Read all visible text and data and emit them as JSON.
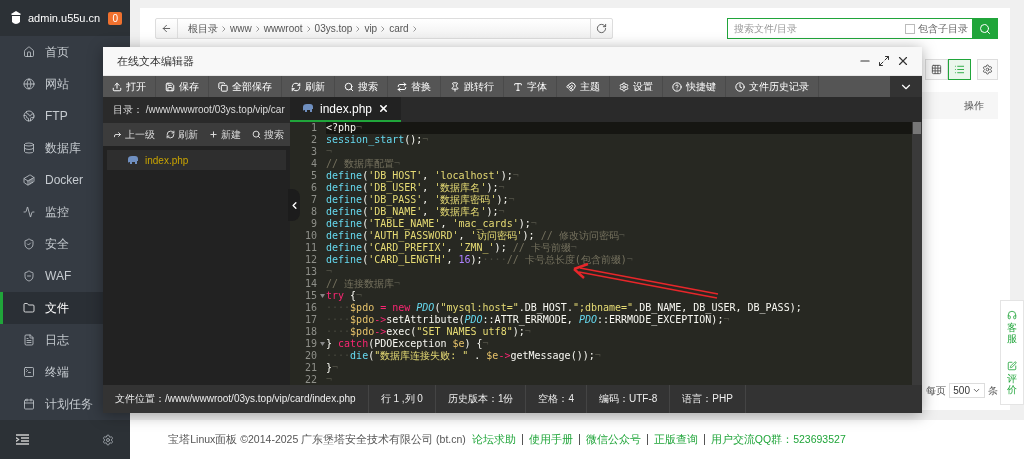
{
  "sidebar": {
    "site_name": "admin.u55u.cn",
    "badge": "0",
    "items": [
      {
        "label": "首页",
        "selected": false
      },
      {
        "label": "网站",
        "selected": false
      },
      {
        "label": "FTP",
        "selected": false
      },
      {
        "label": "数据库",
        "selected": false
      },
      {
        "label": "Docker",
        "selected": false
      },
      {
        "label": "监控",
        "selected": false
      },
      {
        "label": "安全",
        "selected": false
      },
      {
        "label": "WAF",
        "selected": false
      },
      {
        "label": "文件",
        "selected": true
      },
      {
        "label": "日志",
        "selected": false
      },
      {
        "label": "终端",
        "selected": false
      },
      {
        "label": "计划任务",
        "selected": false
      }
    ]
  },
  "breadcrumb": [
    "根目录",
    "www",
    "wwwroot",
    "03ys.top",
    "vip",
    "card"
  ],
  "search": {
    "placeholder": "搜索文件/目录",
    "include_subdirs": {
      "label": "包含子目录",
      "checked": false
    }
  },
  "view_toggle": [
    {
      "selected": false
    },
    {
      "selected": true
    }
  ],
  "table": {
    "columns": [
      "操作"
    ]
  },
  "pagination": {
    "prefix": "每页",
    "per_page": "500",
    "suffix": "条"
  },
  "float_widget": [
    "客服",
    "评价"
  ],
  "footer": {
    "text": "宝塔Linux面板 ©2014-2025 广东堡塔安全技术有限公司 (bt.cn)",
    "links": [
      "论坛求助",
      "使用手册",
      "微信公众号",
      "正版查询",
      "用户交流QQ群：523693527"
    ]
  },
  "editor": {
    "title": "在线文本编辑器",
    "toolbar": [
      "打开",
      "保存",
      "全部保存",
      "刷新",
      "搜索",
      "替换",
      "跳转行",
      "字体",
      "主题",
      "设置",
      "快捷键",
      "文件历史记录"
    ],
    "dir_label": "目录：",
    "dir_path": "/www/wwwroot/03ys.top/vip/car",
    "file_toolbar": [
      "上一级",
      "刷新",
      "新建",
      "搜索"
    ],
    "files": [
      {
        "name": "index.php",
        "selected": true
      }
    ],
    "tabs": [
      {
        "label": "index.php",
        "selected": true
      }
    ],
    "code": [
      {
        "number": "1",
        "active": true,
        "fold": false,
        "tokens": [
          {
            "kind": "plain",
            "text": "<?php"
          },
          {
            "kind": "ws",
            "text": "¬"
          }
        ]
      },
      {
        "number": "2",
        "active": false,
        "fold": false,
        "tokens": [
          {
            "kind": "func",
            "text": "session_start"
          },
          {
            "kind": "plain",
            "text": "();"
          },
          {
            "kind": "ws",
            "text": "¬"
          }
        ]
      },
      {
        "number": "3",
        "active": false,
        "fold": false,
        "tokens": [
          {
            "kind": "ws",
            "text": "¬"
          }
        ]
      },
      {
        "number": "4",
        "active": false,
        "fold": false,
        "tokens": [
          {
            "kind": "comment",
            "text": "// 数据库配置"
          },
          {
            "kind": "ws",
            "text": "¬"
          }
        ]
      },
      {
        "number": "5",
        "active": false,
        "fold": false,
        "tokens": [
          {
            "kind": "func",
            "text": "define"
          },
          {
            "kind": "plain",
            "text": "("
          },
          {
            "kind": "string",
            "text": "'DB_HOST'"
          },
          {
            "kind": "plain",
            "text": ", "
          },
          {
            "kind": "string",
            "text": "'localhost'"
          },
          {
            "kind": "plain",
            "text": ");"
          },
          {
            "kind": "ws",
            "text": "¬"
          }
        ]
      },
      {
        "number": "6",
        "active": false,
        "fold": false,
        "tokens": [
          {
            "kind": "func",
            "text": "define"
          },
          {
            "kind": "plain",
            "text": "("
          },
          {
            "kind": "string",
            "text": "'DB_USER'"
          },
          {
            "kind": "plain",
            "text": ", "
          },
          {
            "kind": "string",
            "text": "'数据库名'"
          },
          {
            "kind": "plain",
            "text": ");"
          },
          {
            "kind": "ws",
            "text": "¬"
          }
        ]
      },
      {
        "number": "7",
        "active": false,
        "fold": false,
        "tokens": [
          {
            "kind": "func",
            "text": "define"
          },
          {
            "kind": "plain",
            "text": "("
          },
          {
            "kind": "string",
            "text": "'DB_PASS'"
          },
          {
            "kind": "plain",
            "text": ", "
          },
          {
            "kind": "string",
            "text": "'数据库密码'"
          },
          {
            "kind": "plain",
            "text": ");"
          },
          {
            "kind": "ws",
            "text": "¬"
          }
        ]
      },
      {
        "number": "8",
        "active": false,
        "fold": false,
        "tokens": [
          {
            "kind": "func",
            "text": "define"
          },
          {
            "kind": "plain",
            "text": "("
          },
          {
            "kind": "string",
            "text": "'DB_NAME'"
          },
          {
            "kind": "plain",
            "text": ", "
          },
          {
            "kind": "string",
            "text": "'数据库名'"
          },
          {
            "kind": "plain",
            "text": ");"
          },
          {
            "kind": "ws",
            "text": "¬"
          }
        ]
      },
      {
        "number": "9",
        "active": false,
        "fold": false,
        "tokens": [
          {
            "kind": "func",
            "text": "define"
          },
          {
            "kind": "plain",
            "text": "("
          },
          {
            "kind": "string",
            "text": "'TABLE_NAME'"
          },
          {
            "kind": "plain",
            "text": ", "
          },
          {
            "kind": "string",
            "text": "'mac_cards'"
          },
          {
            "kind": "plain",
            "text": ");"
          },
          {
            "kind": "ws",
            "text": "¬"
          }
        ]
      },
      {
        "number": "10",
        "active": false,
        "fold": false,
        "tokens": [
          {
            "kind": "func",
            "text": "define"
          },
          {
            "kind": "plain",
            "text": "("
          },
          {
            "kind": "string",
            "text": "'AUTH_PASSWORD'"
          },
          {
            "kind": "plain",
            "text": ", "
          },
          {
            "kind": "string",
            "text": "'访问密码'"
          },
          {
            "kind": "plain",
            "text": "); "
          },
          {
            "kind": "comment",
            "text": "// 修改访问密码"
          },
          {
            "kind": "ws",
            "text": "¬"
          }
        ]
      },
      {
        "number": "11",
        "active": false,
        "fold": false,
        "tokens": [
          {
            "kind": "func",
            "text": "define"
          },
          {
            "kind": "plain",
            "text": "("
          },
          {
            "kind": "string",
            "text": "'CARD_PREFIX'"
          },
          {
            "kind": "plain",
            "text": ", "
          },
          {
            "kind": "string",
            "text": "'ZMN_'"
          },
          {
            "kind": "plain",
            "text": "); "
          },
          {
            "kind": "comment",
            "text": "// 卡号前缀"
          },
          {
            "kind": "ws",
            "text": "¬"
          }
        ]
      },
      {
        "number": "12",
        "active": false,
        "fold": false,
        "tokens": [
          {
            "kind": "func",
            "text": "define"
          },
          {
            "kind": "plain",
            "text": "("
          },
          {
            "kind": "string",
            "text": "'CARD_LENGTH'"
          },
          {
            "kind": "plain",
            "text": ", "
          },
          {
            "kind": "number",
            "text": "16"
          },
          {
            "kind": "plain",
            "text": ");"
          },
          {
            "kind": "ws",
            "text": "····"
          },
          {
            "kind": "comment",
            "text": "// 卡号总长度(包含前缀)"
          },
          {
            "kind": "ws",
            "text": "¬"
          }
        ]
      },
      {
        "number": "13",
        "active": false,
        "fold": false,
        "tokens": [
          {
            "kind": "ws",
            "text": "¬"
          }
        ]
      },
      {
        "number": "14",
        "active": false,
        "fold": false,
        "tokens": [
          {
            "kind": "comment",
            "text": "// 连接数据库"
          },
          {
            "kind": "ws",
            "text": "¬"
          }
        ]
      },
      {
        "number": "15",
        "active": false,
        "fold": true,
        "tokens": [
          {
            "kind": "keyword",
            "text": "try"
          },
          {
            "kind": "plain",
            "text": " {"
          },
          {
            "kind": "ws",
            "text": "¬"
          }
        ]
      },
      {
        "number": "16",
        "active": false,
        "fold": false,
        "tokens": [
          {
            "kind": "ws",
            "text": "····"
          },
          {
            "kind": "var",
            "text": "$pdo "
          },
          {
            "kind": "keyword",
            "text": "= new"
          },
          {
            "kind": "class",
            "text": " PDO"
          },
          {
            "kind": "plain",
            "text": "("
          },
          {
            "kind": "string",
            "text": "\"mysql:host=\""
          },
          {
            "kind": "plain",
            "text": ".DB_HOST."
          },
          {
            "kind": "string",
            "text": "\";dbname=\""
          },
          {
            "kind": "plain",
            "text": ".DB_NAME, DB_USER, DB_PASS);"
          }
        ]
      },
      {
        "number": "17",
        "active": false,
        "fold": false,
        "tokens": [
          {
            "kind": "ws",
            "text": "····"
          },
          {
            "kind": "var",
            "text": "$pdo"
          },
          {
            "kind": "keyword",
            "text": "->"
          },
          {
            "kind": "plain",
            "text": "setAttribute("
          },
          {
            "kind": "class",
            "text": "PDO"
          },
          {
            "kind": "plain",
            "text": "::ATTR_ERRMODE, "
          },
          {
            "kind": "class",
            "text": "PDO"
          },
          {
            "kind": "plain",
            "text": "::ERRMODE_EXCEPTION);"
          },
          {
            "kind": "ws",
            "text": "¬"
          }
        ]
      },
      {
        "number": "18",
        "active": false,
        "fold": false,
        "tokens": [
          {
            "kind": "ws",
            "text": "····"
          },
          {
            "kind": "var",
            "text": "$pdo"
          },
          {
            "kind": "keyword",
            "text": "->"
          },
          {
            "kind": "plain",
            "text": "exec("
          },
          {
            "kind": "string",
            "text": "\"SET NAMES utf8\""
          },
          {
            "kind": "plain",
            "text": ");"
          },
          {
            "kind": "ws",
            "text": "¬"
          }
        ]
      },
      {
        "number": "19",
        "active": false,
        "fold": true,
        "tokens": [
          {
            "kind": "plain",
            "text": "} "
          },
          {
            "kind": "keyword",
            "text": "catch"
          },
          {
            "kind": "plain",
            "text": "(PDOException "
          },
          {
            "kind": "var",
            "text": "$e"
          },
          {
            "kind": "plain",
            "text": ") {"
          },
          {
            "kind": "ws",
            "text": "¬"
          }
        ]
      },
      {
        "number": "20",
        "active": false,
        "fold": false,
        "tokens": [
          {
            "kind": "ws",
            "text": "····"
          },
          {
            "kind": "func",
            "text": "die"
          },
          {
            "kind": "plain",
            "text": "("
          },
          {
            "kind": "string",
            "text": "\"数据库连接失败: \""
          },
          {
            "kind": "plain",
            "text": " . "
          },
          {
            "kind": "var",
            "text": "$e"
          },
          {
            "kind": "keyword",
            "text": "->"
          },
          {
            "kind": "plain",
            "text": "getMessage());"
          },
          {
            "kind": "ws",
            "text": "¬"
          }
        ]
      },
      {
        "number": "21",
        "active": false,
        "fold": false,
        "tokens": [
          {
            "kind": "plain",
            "text": "}"
          },
          {
            "kind": "ws",
            "text": "¬"
          }
        ]
      },
      {
        "number": "22",
        "active": false,
        "fold": false,
        "tokens": [
          {
            "kind": "ws",
            "text": "¬"
          }
        ]
      }
    ],
    "status": [
      "文件位置：/www/wwwroot/03ys.top/vip/card/index.php",
      "行 1 ,列 0",
      "历史版本：1份",
      "空格：4",
      "编码：UTF-8",
      "语言：PHP"
    ]
  }
}
